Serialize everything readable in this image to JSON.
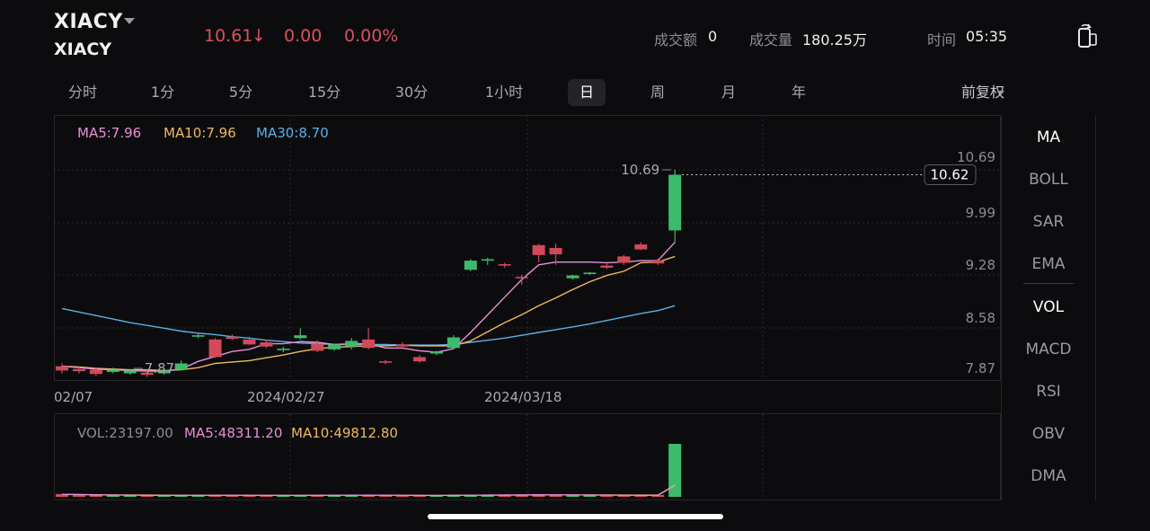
{
  "header": {
    "symbol": "XIACY",
    "name": "XIACY",
    "price": "10.61",
    "arrow": "↓",
    "change": "0.00",
    "change_pct": "0.00%",
    "turnover_label": "成交额",
    "turnover_value": "0",
    "volume_label": "成交量",
    "volume_value": "180.25万",
    "time_label": "时间",
    "time_value": "05:35",
    "price_color": "#d9505d"
  },
  "tabs": [
    "分时",
    "1分",
    "5分",
    "15分",
    "30分",
    "1小时",
    "日",
    "周",
    "月",
    "年"
  ],
  "active_tab": "日",
  "adjust_label": "前复权",
  "indicators": {
    "main": [
      "MA",
      "BOLL",
      "SAR",
      "EMA"
    ],
    "sub": [
      "VOL",
      "MACD",
      "RSI",
      "OBV",
      "DMA"
    ],
    "active_main": "MA",
    "active_sub": "VOL"
  },
  "chart_data": [
    {
      "type": "candlestick",
      "legend": {
        "ma5": "MA5:7.96",
        "ma10": "MA10:7.96",
        "ma30": "MA30:8.70"
      },
      "colors": {
        "up": "#3dbb6c",
        "down": "#d04a58",
        "ma5": "#e890d8",
        "ma10": "#f0b860",
        "ma30": "#5cb0e6"
      },
      "y_ticks": [
        "10.69",
        "9.99",
        "9.28",
        "8.58",
        "7.87"
      ],
      "ylim": [
        7.87,
        10.69
      ],
      "x_labels": [
        "02/07",
        "2024/02/27",
        "2024/03/18"
      ],
      "high_label": "10.69",
      "low_label": "7.87",
      "last_price_label": "10.62",
      "candles": [
        {
          "o": 7.9,
          "h": 7.94,
          "c": 7.84,
          "l": 7.8
        },
        {
          "o": 7.86,
          "h": 7.9,
          "c": 7.83,
          "l": 7.8
        },
        {
          "o": 7.85,
          "h": 7.88,
          "c": 7.79,
          "l": 7.76
        },
        {
          "o": 7.82,
          "h": 7.88,
          "c": 7.85,
          "l": 7.8
        },
        {
          "o": 7.8,
          "h": 7.86,
          "c": 7.84,
          "l": 7.78
        },
        {
          "o": 7.81,
          "h": 7.85,
          "c": 7.78,
          "l": 7.75
        },
        {
          "o": 7.8,
          "h": 7.86,
          "c": 7.84,
          "l": 7.78
        },
        {
          "o": 7.85,
          "h": 7.98,
          "c": 7.94,
          "l": 7.84
        },
        {
          "o": 8.32,
          "h": 8.36,
          "c": 8.34,
          "l": 8.3
        },
        {
          "o": 8.28,
          "h": 8.3,
          "c": 8.03,
          "l": 8.02
        },
        {
          "o": 8.32,
          "h": 8.35,
          "c": 8.29,
          "l": 8.27
        },
        {
          "o": 8.28,
          "h": 8.32,
          "c": 8.21,
          "l": 8.2
        },
        {
          "o": 8.24,
          "h": 8.28,
          "c": 8.18,
          "l": 8.16
        },
        {
          "o": 8.14,
          "h": 8.18,
          "c": 8.15,
          "l": 8.1
        },
        {
          "o": 8.3,
          "h": 8.44,
          "c": 8.34,
          "l": 8.28
        },
        {
          "o": 8.22,
          "h": 8.27,
          "c": 8.12,
          "l": 8.1
        },
        {
          "o": 8.14,
          "h": 8.22,
          "c": 8.21,
          "l": 8.12
        },
        {
          "o": 8.18,
          "h": 8.3,
          "c": 8.26,
          "l": 8.14
        },
        {
          "o": 8.28,
          "h": 8.44,
          "c": 8.16,
          "l": 8.14
        },
        {
          "o": 7.97,
          "h": 7.99,
          "c": 7.95,
          "l": 7.93
        },
        {
          "o": 8.21,
          "h": 8.24,
          "c": 8.18,
          "l": 8.14
        },
        {
          "o": 8.03,
          "h": 8.06,
          "c": 7.97,
          "l": 7.95
        },
        {
          "o": 8.08,
          "h": 8.12,
          "c": 8.11,
          "l": 8.06
        },
        {
          "o": 8.16,
          "h": 8.34,
          "c": 8.31,
          "l": 8.14
        },
        {
          "o": 9.27,
          "h": 9.42,
          "c": 9.4,
          "l": 9.25
        },
        {
          "o": 9.4,
          "h": 9.44,
          "c": 9.42,
          "l": 9.34
        },
        {
          "o": 9.35,
          "h": 9.37,
          "c": 9.34,
          "l": 9.3
        },
        {
          "o": 9.17,
          "h": 9.2,
          "c": 9.16,
          "l": 9.06
        },
        {
          "o": 9.62,
          "h": 9.64,
          "c": 9.48,
          "l": 9.38
        },
        {
          "o": 9.58,
          "h": 9.64,
          "c": 9.49,
          "l": 9.34
        },
        {
          "o": 9.15,
          "h": 9.2,
          "c": 9.19,
          "l": 9.13
        },
        {
          "o": 9.22,
          "h": 9.24,
          "c": 9.23,
          "l": 9.2
        },
        {
          "o": 9.33,
          "h": 9.36,
          "c": 9.3,
          "l": 9.28
        },
        {
          "o": 9.46,
          "h": 9.48,
          "c": 9.37,
          "l": 9.34
        },
        {
          "o": 9.63,
          "h": 9.66,
          "c": 9.56,
          "l": 9.55
        },
        {
          "o": 9.4,
          "h": 9.43,
          "c": 9.36,
          "l": 9.34
        },
        {
          "o": 9.83,
          "h": 10.69,
          "c": 10.62,
          "l": 9.66
        }
      ],
      "ma5": [
        7.9,
        7.88,
        7.86,
        7.85,
        7.84,
        7.83,
        7.83,
        7.86,
        7.97,
        8.04,
        8.11,
        8.14,
        8.22,
        8.22,
        8.25,
        8.24,
        8.21,
        8.22,
        8.22,
        8.16,
        8.16,
        8.12,
        8.1,
        8.15,
        8.38,
        8.63,
        8.88,
        9.13,
        9.34,
        9.38,
        9.38,
        9.38,
        9.37,
        9.38,
        9.4,
        9.4,
        9.66
      ],
      "ma10": [
        7.9,
        7.89,
        7.87,
        7.86,
        7.85,
        7.85,
        7.84,
        7.85,
        7.88,
        7.94,
        7.96,
        7.98,
        8.02,
        8.06,
        8.11,
        8.15,
        8.17,
        8.18,
        8.19,
        8.19,
        8.2,
        8.19,
        8.19,
        8.19,
        8.26,
        8.39,
        8.52,
        8.63,
        8.76,
        8.87,
        8.99,
        9.1,
        9.19,
        9.25,
        9.37,
        9.38,
        9.46
      ],
      "ma30": [
        8.72,
        8.67,
        8.62,
        8.57,
        8.52,
        8.48,
        8.44,
        8.4,
        8.37,
        8.35,
        8.32,
        8.3,
        8.27,
        8.25,
        8.23,
        8.22,
        8.21,
        8.21,
        8.21,
        8.21,
        8.2,
        8.2,
        8.2,
        8.21,
        8.24,
        8.27,
        8.3,
        8.34,
        8.38,
        8.42,
        8.46,
        8.5,
        8.55,
        8.6,
        8.65,
        8.69,
        8.76
      ]
    },
    {
      "type": "bar",
      "legend": {
        "vol": "VOL:23197.00",
        "ma5": "MA5:48311.20",
        "ma10": "MA10:49812.80"
      },
      "volumes": [
        12000,
        9000,
        8000,
        7000,
        6500,
        6000,
        6000,
        7500,
        6000,
        8000,
        6500,
        6000,
        5500,
        5500,
        7000,
        9000,
        8000,
        7000,
        6500,
        6000,
        5000,
        5500,
        6500,
        9000,
        8500,
        9500,
        7000,
        7000,
        11000,
        9000,
        6500,
        6000,
        5500,
        6000,
        7000,
        8000,
        225000
      ],
      "vol_ma5": [
        10000,
        9500,
        8500,
        7500,
        7000,
        6500,
        6200,
        6500,
        6400,
        6600,
        6800,
        6600,
        6400,
        6100,
        6200,
        6600,
        7000,
        7200,
        7400,
        7100,
        6600,
        6000,
        5900,
        6300,
        6900,
        7700,
        8100,
        8300,
        9000,
        8800,
        8200,
        7600,
        7000,
        6800,
        6200,
        6500,
        48311
      ],
      "vol_ma10": [
        10500,
        10000,
        9200,
        8500,
        8000,
        7500,
        7100,
        7000,
        6900,
        6900,
        6800,
        6700,
        6600,
        6400,
        6300,
        6500,
        6700,
        6800,
        6900,
        6900,
        6700,
        6500,
        6400,
        6500,
        6700,
        7000,
        7300,
        7600,
        8000,
        8200,
        8300,
        8100,
        7900,
        7800,
        7700,
        7600,
        49812
      ]
    }
  ]
}
